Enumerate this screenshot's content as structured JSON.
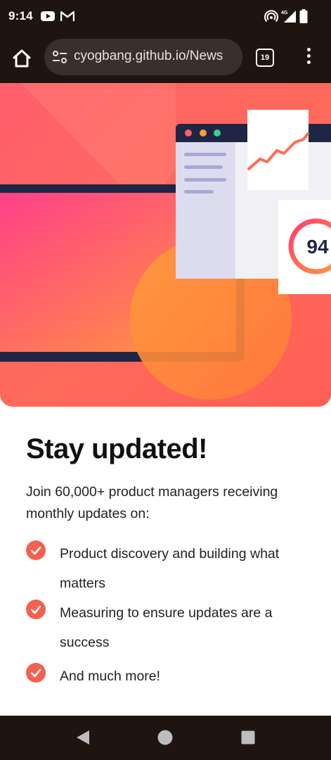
{
  "status_bar": {
    "time": "9:14",
    "network": "4G",
    "icons": [
      "youtube-icon",
      "gmail-icon",
      "hotspot-icon",
      "signal-icon",
      "battery-icon"
    ]
  },
  "browser": {
    "url": "cyogbang.github.io/News",
    "tab_count": "19",
    "icons": [
      "home-icon",
      "site-settings-icon",
      "tabs-icon",
      "more-vert-icon"
    ]
  },
  "hero": {
    "score": "94",
    "colors": {
      "bg_start": "#ff5f6d",
      "bg_end": "#ff7e4a",
      "screen_start": "#ff3d8a",
      "screen_end": "#ff9a3c",
      "frame": "#1f2544"
    }
  },
  "content": {
    "heading": "Stay updated!",
    "intro": "Join 60,000+ product managers receiving monthly updates on:",
    "features": [
      {
        "text": "Product discovery and building what matters"
      },
      {
        "text": "Measuring to ensure updates are a success"
      },
      {
        "text": "And much more!"
      }
    ],
    "accent_color": "#f5604f"
  },
  "nav_bar": {
    "icons": [
      "back-icon",
      "home-circle-icon",
      "recents-icon"
    ]
  }
}
